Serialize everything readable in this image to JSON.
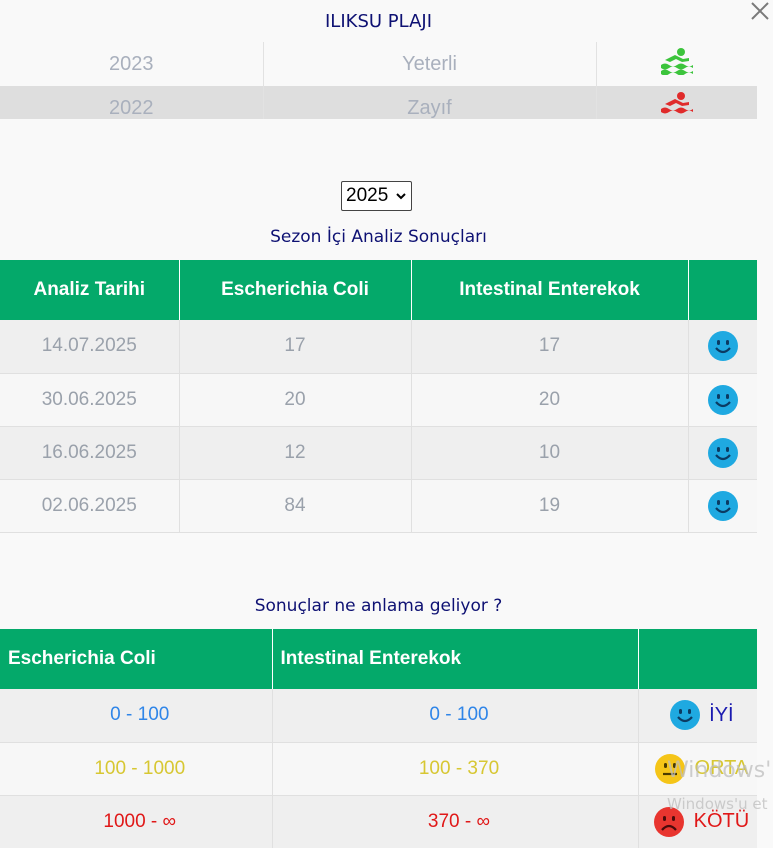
{
  "header": {
    "beach_name": "ILIKSU PLAJI"
  },
  "history": {
    "rows": [
      {
        "year": "2023",
        "quality": "Yeterli",
        "icon": "swimmer-green-icon",
        "color": "#3cc43c"
      },
      {
        "year": "2022",
        "quality": "Zayıf",
        "icon": "swimmer-red-icon",
        "color": "#e02b2b"
      }
    ]
  },
  "year_select": {
    "selected": "2025"
  },
  "results": {
    "title": "Sezon İçi Analiz Sonuçları",
    "columns": [
      "Analiz Tarihi",
      "Escherichia Coli",
      "Intestinal Enterekok",
      ""
    ],
    "rows": [
      {
        "date": "14.07.2025",
        "ecoli": "17",
        "entero": "17",
        "status": "happy-face-icon"
      },
      {
        "date": "30.06.2025",
        "ecoli": "20",
        "entero": "20",
        "status": "happy-face-icon"
      },
      {
        "date": "16.06.2025",
        "ecoli": "12",
        "entero": "10",
        "status": "happy-face-icon"
      },
      {
        "date": "02.06.2025",
        "ecoli": "84",
        "entero": "19",
        "status": "happy-face-icon"
      }
    ]
  },
  "legend": {
    "title": "Sonuçlar ne anlama geliyor ?",
    "columns": [
      "Escherichia Coli",
      "Intestinal Enterekok",
      ""
    ],
    "rows": [
      {
        "ecoli": "0 - 100",
        "entero": "0 - 100",
        "label": "İYİ",
        "icon": "happy-face-icon",
        "color": "#2f85e8"
      },
      {
        "ecoli": "100 - 1000",
        "entero": "100 - 370",
        "label": "ORTA",
        "icon": "neutral-face-icon",
        "color": "#d7c732"
      },
      {
        "ecoli": "1000 - ∞",
        "entero": "370 - ∞",
        "label": "KÖTÜ",
        "icon": "sad-face-icon",
        "color": "#e01818"
      }
    ]
  },
  "watermark": {
    "line1": "Windows'",
    "line2": "Windows'u et"
  },
  "colors": {
    "header_green": "#04a96a",
    "title_navy": "#0e1173",
    "face_blue": "#1fa9e1",
    "face_yellow": "#f5c518",
    "face_red": "#e8352f"
  }
}
